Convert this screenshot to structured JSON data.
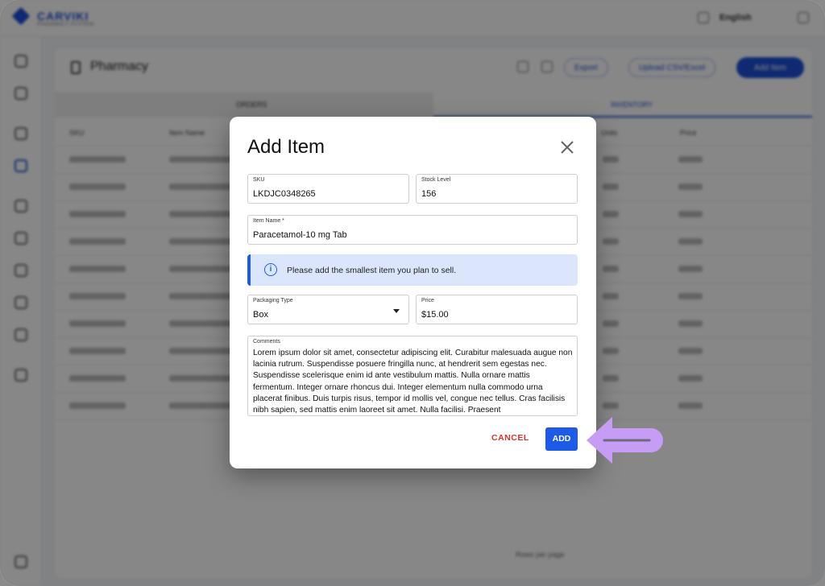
{
  "app": {
    "logo_text": "CARVIKI",
    "logo_sub": "PHARMACY SYSTEM",
    "language": "English"
  },
  "page": {
    "title": "Pharmacy",
    "export_label": "Export",
    "upload_label": "Upload CSV/Excel",
    "add_label": "Add Item",
    "tab_orders": "ORDERS",
    "tab_inventory": "INVENTORY",
    "columns": [
      "SKU",
      "Item Name",
      "Units",
      "Price"
    ],
    "pagination_label": "Rows per page"
  },
  "dialog": {
    "title": "Add Item",
    "sku": {
      "label": "SKU",
      "value": "LKDJC0348265"
    },
    "stock": {
      "label": "Stock Level",
      "value": "156"
    },
    "item_name": {
      "label": "Item Name *",
      "value": "Paracetamol-10 mg Tab"
    },
    "info_message": "Please add the smallest item you plan to sell.",
    "packaging": {
      "label": "Packaging Type",
      "value": "Box"
    },
    "price": {
      "label": "Price",
      "value": "$15.00"
    },
    "comments": {
      "label": "Comments",
      "value": "Lorem ipsum dolor sit amet, consectetur adipiscing elit. Curabitur malesuada augue non lacinia rutrum. Suspendisse posuere fringilla nunc, at hendrerit sem egestas nec. Suspendisse scelerisque enim id ante vestibulum mattis. Nulla ornare mattis fermentum. Integer ornare rhoncus dui. Integer elementum nulla commodo urna placerat finibus. Duis turpis risus, tempor id mollis vel, congue nec tellus. Cras facilisis nibh sapien, sed mattis enim laoreet sit amet. Nulla facilisi. Praesent"
    },
    "cancel_label": "CANCEL",
    "add_label": "ADD",
    "icons": {
      "close": "close-icon",
      "info": "info-icon",
      "dropdown": "caret-down-icon"
    }
  },
  "colors": {
    "primary": "#1d5ae6",
    "danger": "#d9302c",
    "info_bg": "#dbe6fd",
    "highlight_arrow": "#c79cf5"
  }
}
